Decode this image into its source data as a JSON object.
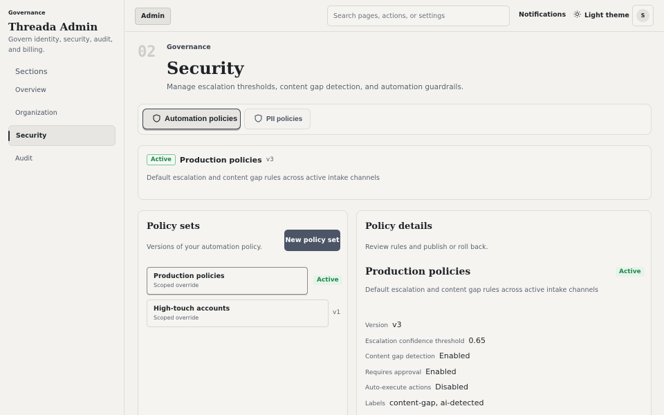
{
  "sidebar": {
    "eyebrow": "Governance",
    "title": "Threada Admin",
    "description": "Govern identity, security, audit, and billing.",
    "sections_label": "Sections",
    "items": [
      {
        "label": "Overview",
        "active": false
      },
      {
        "label": "Organization",
        "active": false
      },
      {
        "label": "Security",
        "active": true
      },
      {
        "label": "Audit",
        "active": false
      }
    ]
  },
  "topbar": {
    "role_label": "Admin",
    "search_placeholder": "Search pages, actions, or settings",
    "notifications_label": "Notifications",
    "theme_label": "Light theme",
    "avatar_initial": "S"
  },
  "header": {
    "step": "02",
    "eyebrow": "Governance",
    "title": "Security",
    "description": "Manage escalation thresholds, content gap detection, and automation guardrails."
  },
  "tabs": [
    {
      "label": "Automation policies",
      "active": true
    },
    {
      "label": "PII policies",
      "active": false
    }
  ],
  "summary": {
    "status": "Active",
    "name": "Production policies",
    "version": "v3",
    "description": "Default escalation and content gap rules across active intake channels"
  },
  "policy_sets": {
    "title": "Policy sets",
    "description": "Versions of your automation policy.",
    "new_button": "New policy set",
    "items": [
      {
        "name": "Production policies",
        "sub": "Scoped override",
        "tag": "Active",
        "selected": true
      },
      {
        "name": "High-touch accounts",
        "sub": "Scoped override",
        "tag": "v1",
        "selected": false
      }
    ]
  },
  "details": {
    "title": "Policy details",
    "description": "Review rules and publish or roll back.",
    "policy_name": "Production policies",
    "status": "Active",
    "policy_description": "Default escalation and content gap rules across active intake channels",
    "fields": [
      {
        "label": "Version",
        "value": "v3"
      },
      {
        "label": "Escalation confidence threshold",
        "value": "0.65"
      },
      {
        "label": "Content gap detection",
        "value": "Enabled"
      },
      {
        "label": "Requires approval",
        "value": "Enabled"
      },
      {
        "label": "Auto-execute actions",
        "value": "Disabled"
      },
      {
        "label": "Labels",
        "value": "content-gap, ai-detected"
      }
    ]
  },
  "colors": {
    "accent": "#4b5566",
    "success": "#1e8a4a",
    "background": "#f3f2ee"
  }
}
